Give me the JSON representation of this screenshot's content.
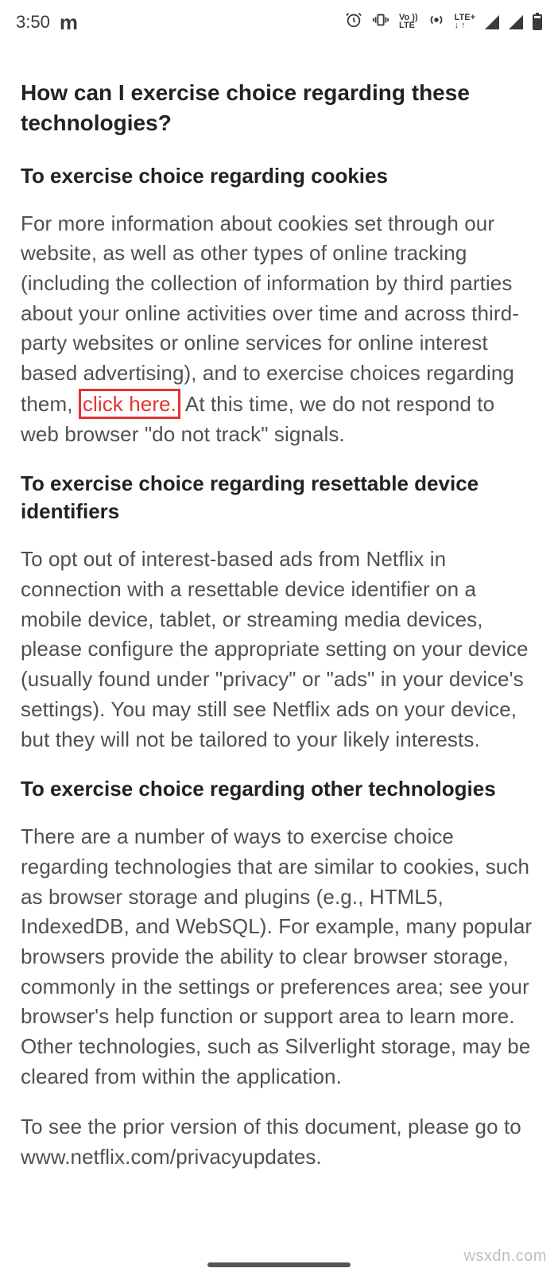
{
  "statusbar": {
    "time": "3:50",
    "m_icon": "m",
    "vo_top": "Vo ))",
    "vo_bottom": "LTE",
    "lteplus_top": "LTE+",
    "lteplus_bottom": "↓ ↑"
  },
  "content": {
    "heading_main": "How can I exercise choice regarding these technologies?",
    "heading_cookies": "To exercise choice regarding cookies",
    "para_cookies_a": "For more information about cookies set through our website, as well as other types of online tracking (including the collection of information by third parties about your online activities over time and across third-party websites or online services for online interest based advertising), and to exercise choices regarding them,",
    "link_click_here": " click here.",
    "para_cookies_b": " At this time, we do not respond to web browser \"do not track\" signals.",
    "heading_resettable": "To exercise choice regarding resettable device identifiers",
    "para_resettable": "To opt out of interest-based ads from Netflix in connection with a resettable device identifier on a mobile device, tablet, or streaming media devices, please configure the appropriate setting on your device (usually found under \"privacy\" or \"ads\" in your device's settings). You may still see Netflix ads on your device, but they will not be tailored to your likely interests.",
    "heading_other": "To exercise choice regarding other technologies",
    "para_other": "There are a number of ways to exercise choice regarding technologies that are similar to cookies, such as browser storage and plugins (e.g., HTML5, IndexedDB, and WebSQL). For example, many popular browsers provide the ability to clear browser storage, commonly in the settings or preferences area; see your browser's help function or support area to learn more. Other technologies, such as Silverlight storage, may be cleared from within the application.",
    "para_prior": "To see the prior version of this document, please go to www.netflix.com/privacyupdates."
  },
  "watermark": "wsxdn.com"
}
